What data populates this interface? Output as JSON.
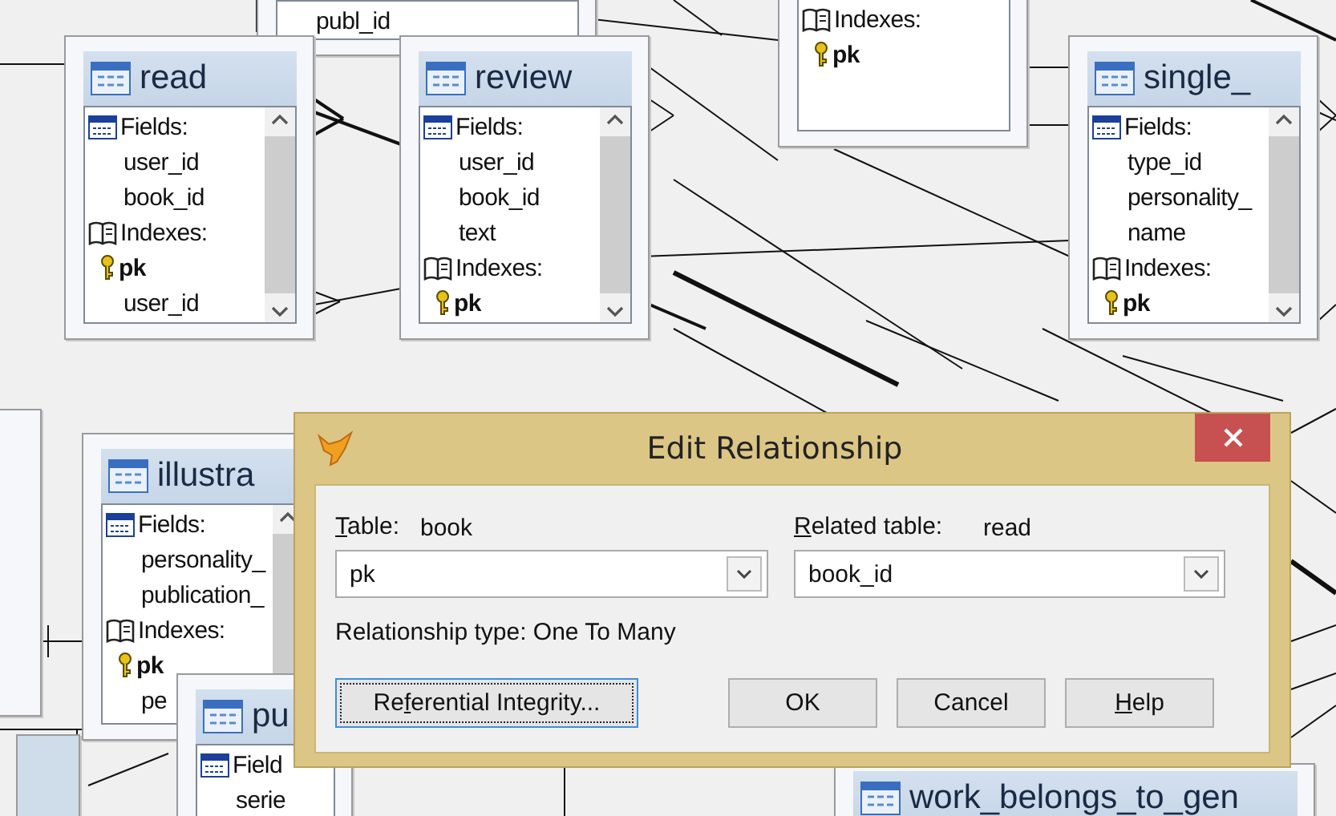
{
  "tables": [
    {
      "rows": [
        {
          "kind": "field",
          "text": "publ_id"
        }
      ]
    },
    {
      "title": "read",
      "rows": [
        {
          "kind": "fields_header",
          "text": "Fields:"
        },
        {
          "kind": "field",
          "text": "user_id"
        },
        {
          "kind": "field",
          "text": "book_id"
        },
        {
          "kind": "indexes_header",
          "text": "Indexes:"
        },
        {
          "kind": "primary_key",
          "text": "pk"
        },
        {
          "kind": "index",
          "text": "user_id"
        }
      ]
    },
    {
      "title": "review",
      "rows": [
        {
          "kind": "fields_header",
          "text": "Fields:"
        },
        {
          "kind": "field",
          "text": "user_id"
        },
        {
          "kind": "field",
          "text": "book_id"
        },
        {
          "kind": "field",
          "text": "text"
        },
        {
          "kind": "indexes_header",
          "text": "Indexes:"
        },
        {
          "kind": "primary_key",
          "text": "pk"
        }
      ]
    },
    {
      "rows": [
        {
          "kind": "indexes_header",
          "text": "Indexes:"
        },
        {
          "kind": "primary_key",
          "text": "pk"
        }
      ]
    },
    {
      "title": "single_",
      "rows": [
        {
          "kind": "fields_header",
          "text": "Fields:"
        },
        {
          "kind": "field",
          "text": "type_id"
        },
        {
          "kind": "field",
          "text": "personality_"
        },
        {
          "kind": "field",
          "text": "name"
        },
        {
          "kind": "indexes_header",
          "text": "Indexes:"
        },
        {
          "kind": "primary_key",
          "text": "pk"
        }
      ]
    },
    {
      "title": "illustra",
      "rows": [
        {
          "kind": "fields_header",
          "text": "Fields:"
        },
        {
          "kind": "field",
          "text": "personality_"
        },
        {
          "kind": "field",
          "text": "publication_"
        },
        {
          "kind": "indexes_header",
          "text": "Indexes:"
        },
        {
          "kind": "primary_key",
          "text": "pk"
        },
        {
          "kind": "index",
          "text": "pe"
        }
      ]
    },
    {
      "title": "pu",
      "rows": [
        {
          "kind": "fields_header",
          "text": "Field"
        },
        {
          "kind": "field",
          "text": "serie"
        }
      ]
    },
    {
      "title": "work_belongs_to_gen"
    }
  ],
  "dialog": {
    "title": "Edit Relationship",
    "table_label": {
      "key": "T",
      "post": "able:"
    },
    "table_name": "book",
    "table_key": "pk",
    "related_label": {
      "key": "R",
      "post": "elated table:"
    },
    "related_name": "read",
    "related_key": "book_id",
    "relationship_type": "Relationship type:  One To Many",
    "buttons": [
      {
        "label": {
          "pre": "Re",
          "key": "f",
          "post": "erential Integrity..."
        },
        "focused": true
      },
      {
        "label": {
          "pre": "OK"
        },
        "focused": false
      },
      {
        "label": {
          "pre": "Cancel"
        },
        "focused": false
      },
      {
        "label": {
          "key": "H",
          "post": "elp"
        },
        "focused": false
      }
    ]
  }
}
